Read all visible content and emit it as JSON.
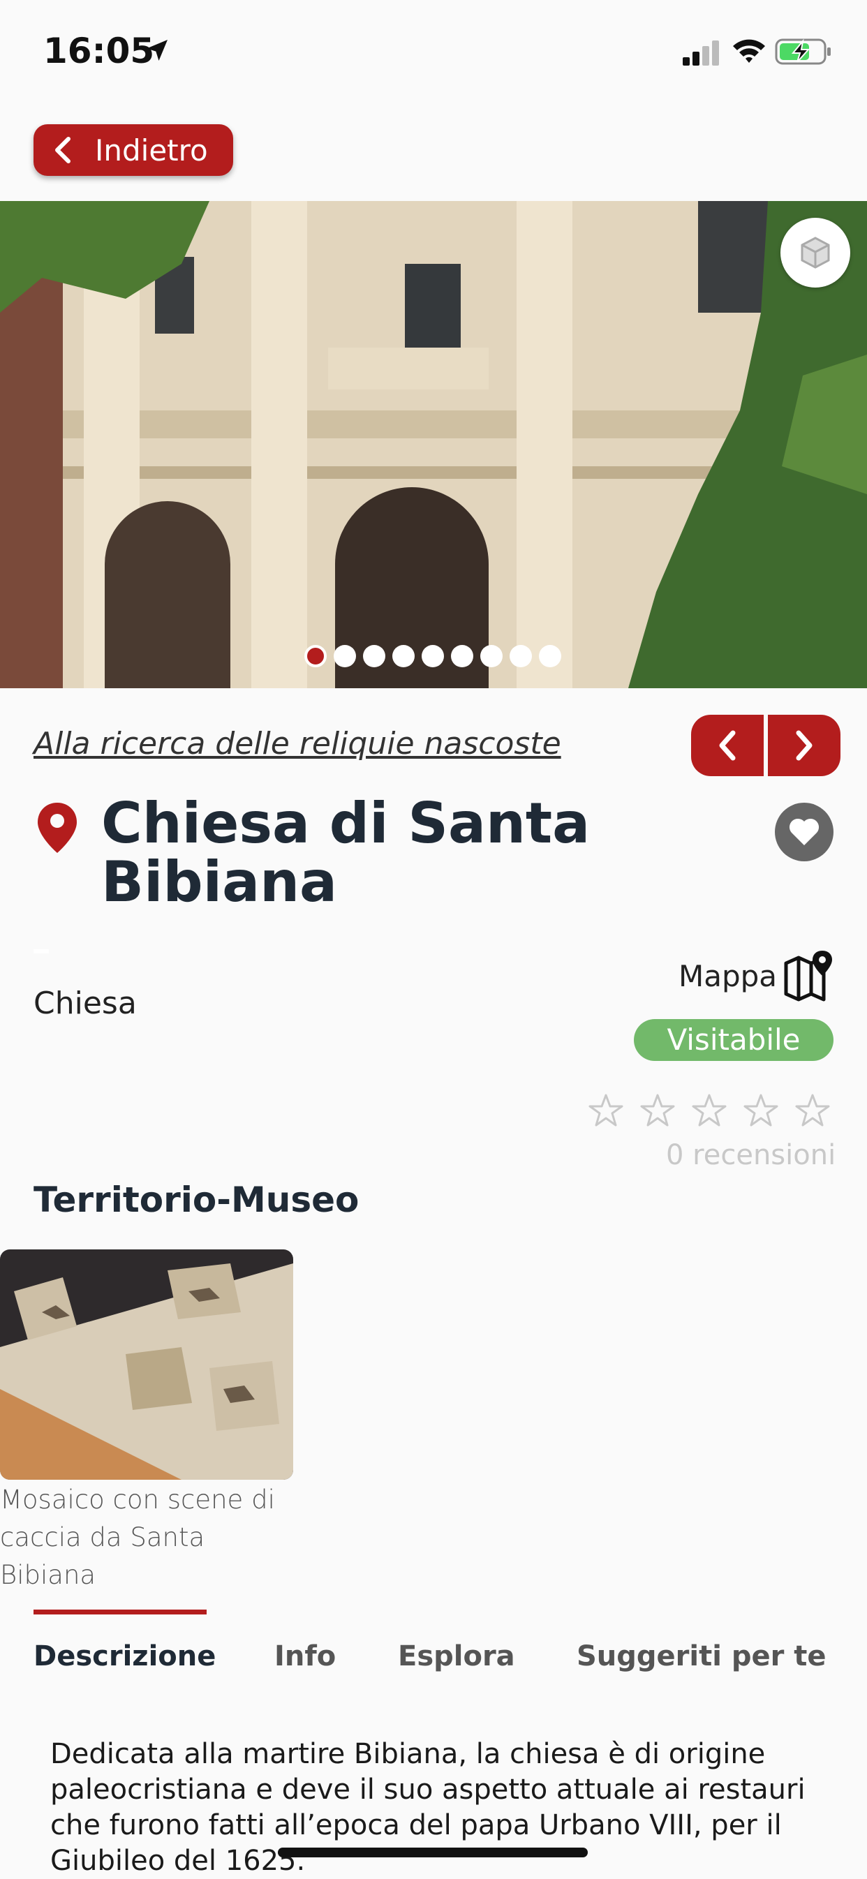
{
  "status_bar": {
    "time": "16:05"
  },
  "header": {
    "back_label": "Indietro"
  },
  "hero": {
    "slide_count": 9,
    "active_slide": 1
  },
  "poi": {
    "itinerary_link": "Alla ricerca delle reliquie nascoste",
    "title": "Chiesa di Santa Bibiana",
    "category": "Chiesa",
    "map_label": "Mappa",
    "status_badge": "Visitabile",
    "rating": 0,
    "reviews": "0 recensioni"
  },
  "museum": {
    "section_title": "Territorio-Museo",
    "items": [
      {
        "caption": "Mosaico con scene di caccia da Santa Bibiana"
      }
    ]
  },
  "tabs": [
    {
      "label": "Descrizione",
      "active": true
    },
    {
      "label": "Info",
      "active": false
    },
    {
      "label": "Esplora",
      "active": false
    },
    {
      "label": "Suggeriti per te",
      "active": false
    }
  ],
  "description": "Dedicata alla martire Bibiana, la chiesa è di origine paleocristiana e deve il suo aspetto attuale ai restauri che furono fatti all’epoca del papa Urbano VIII, per il Giubileo del 1625.",
  "colors": {
    "accent": "#b31d1d",
    "badge_green": "#72b96a",
    "title_text": "#1f2a36"
  },
  "icons": [
    "location-arrow-icon",
    "signal-icon",
    "wifi-icon",
    "battery-charging-icon",
    "chevron-left-icon",
    "ar-cube-icon",
    "chevron-right-icon",
    "map-pin-icon",
    "heart-icon",
    "map-icon",
    "star-icon"
  ]
}
